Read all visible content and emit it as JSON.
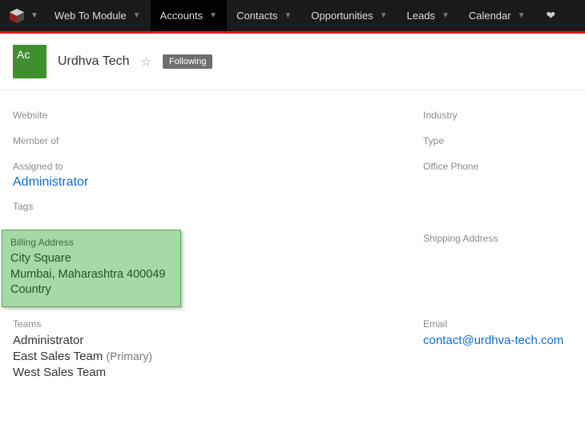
{
  "nav": {
    "brand_icon": "cube-icon",
    "items": [
      {
        "label": "Web To Module",
        "active": false
      },
      {
        "label": "Accounts",
        "active": true
      },
      {
        "label": "Contacts",
        "active": false
      },
      {
        "label": "Opportunities",
        "active": false
      },
      {
        "label": "Leads",
        "active": false
      },
      {
        "label": "Calendar",
        "active": false
      }
    ]
  },
  "header": {
    "avatar_text": "Ac",
    "title": "Urdhva Tech",
    "follow_label": "Following"
  },
  "fields": {
    "website": {
      "label": "Website",
      "value": ""
    },
    "industry": {
      "label": "Industry",
      "value": ""
    },
    "member_of": {
      "label": "Member of",
      "value": ""
    },
    "type": {
      "label": "Type",
      "value": ""
    },
    "assigned_to": {
      "label": "Assigned to",
      "value": "Administrator"
    },
    "office_phone": {
      "label": "Office Phone",
      "value": ""
    },
    "tags": {
      "label": "Tags",
      "value": ""
    },
    "billing_address": {
      "label": "Billing Address",
      "line1": "City Square",
      "line2": "Mumbai, Maharashtra 400049",
      "line3": "Country"
    },
    "shipping_address": {
      "label": "Shipping Address",
      "value": ""
    },
    "teams": {
      "label": "Teams",
      "items": [
        {
          "name": "Administrator",
          "suffix": ""
        },
        {
          "name": "East Sales Team",
          "suffix": "(Primary)"
        },
        {
          "name": "West Sales Team",
          "suffix": ""
        }
      ]
    },
    "email": {
      "label": "Email",
      "value": "contact@urdhva-tech.com"
    }
  }
}
